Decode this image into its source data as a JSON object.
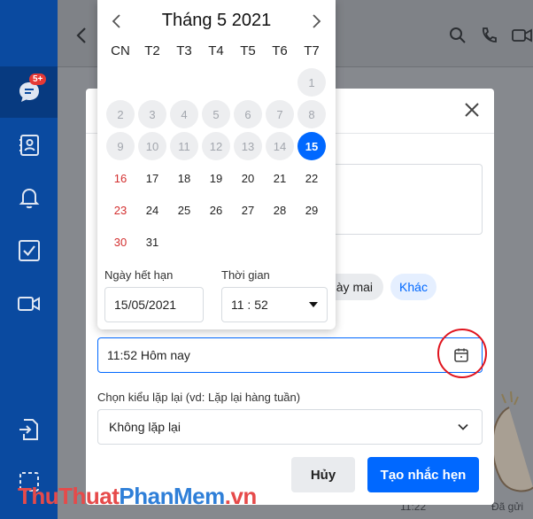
{
  "sidebar": {
    "badge": "5+",
    "items": [
      {
        "icon": "chat-icon"
      },
      {
        "icon": "contact-card-icon"
      },
      {
        "icon": "bell-icon"
      },
      {
        "icon": "todo-checkbox-icon"
      },
      {
        "icon": "video-icon"
      },
      {
        "icon": "file-import-icon"
      },
      {
        "icon": "dashed-square-icon"
      }
    ]
  },
  "background": {
    "time_text": "11:22",
    "sent_text": "Đã gửi"
  },
  "calendar": {
    "title": "Tháng 5 2021",
    "weekdays": [
      "CN",
      "T2",
      "T3",
      "T4",
      "T5",
      "T6",
      "T7"
    ],
    "disabled_days": [
      "1",
      "2",
      "3",
      "4",
      "5",
      "6",
      "7",
      "8",
      "9",
      "10",
      "11",
      "12",
      "13",
      "14"
    ],
    "selected_day": "15",
    "active_days": [
      "16",
      "17",
      "18",
      "19",
      "20",
      "21",
      "22",
      "23",
      "24",
      "25",
      "26",
      "27",
      "28",
      "29",
      "30",
      "31"
    ],
    "expiry_label": "Ngày hết hạn",
    "expiry_value": "15/05/2021",
    "time_label": "Thời gian",
    "time_value": "11 : 52"
  },
  "modal": {
    "quick_tomorrow": "ày mai",
    "quick_other": "Khác",
    "time_field_value": "11:52 Hôm nay",
    "repeat_label": "Chọn kiểu lặp lại (vd: Lặp lại hàng tuần)",
    "repeat_value": "Không lặp lại",
    "cancel_label": "Hủy",
    "create_label": "Tạo nhắc hẹn"
  },
  "watermark": {
    "part1": "ThuThuat",
    "part2": "PhanMem",
    "part3": ".vn"
  },
  "colors": {
    "accent": "#0068ff",
    "sidebar": "#0a4aa0",
    "weekend_red": "#d32f2f",
    "annotation_red": "#e0141e"
  }
}
